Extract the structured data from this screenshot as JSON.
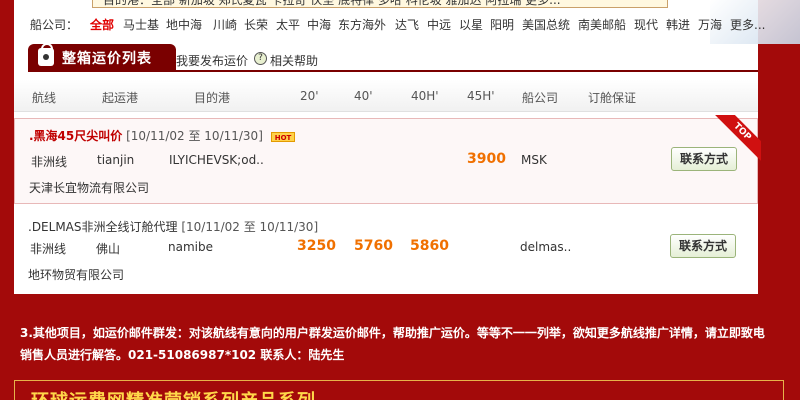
{
  "top_strip": {
    "text": "目的港：全部  新加坡  郑氏夏瓦  卡拉奇  伙坚  底特律  多哈  科伦坡  雅加达  阿拉瑞  更多..."
  },
  "carrier_filter": {
    "label": "船公司：",
    "items": [
      {
        "label": "全部",
        "active": true
      },
      {
        "label": "马士基"
      },
      {
        "label": "地中海"
      },
      {
        "label": "川崎"
      },
      {
        "label": "长荣"
      },
      {
        "label": "太平"
      },
      {
        "label": "中海"
      },
      {
        "label": "东方海外"
      },
      {
        "label": "达飞"
      },
      {
        "label": "中远"
      },
      {
        "label": "以星"
      },
      {
        "label": "阳明"
      },
      {
        "label": "美国总统"
      },
      {
        "label": "南美邮船"
      },
      {
        "label": "现代"
      },
      {
        "label": "韩进"
      },
      {
        "label": "万海"
      },
      {
        "label": "更多..."
      }
    ]
  },
  "tab": {
    "label": "整箱运价列表",
    "icon": "lock-icon",
    "publish_link": "我要发布运价",
    "help_icon": "?",
    "help_link": "相关帮助"
  },
  "table": {
    "headers": [
      "航线",
      "起运港",
      "目的港",
      "20'",
      "40'",
      "40H'",
      "45H'",
      "船公司",
      "订舱保证"
    ],
    "rows": [
      {
        "title": ".黑海45尺尖叫价",
        "date_range": "[10/11/02 至 10/11/30]",
        "hot_badge": "HOT",
        "ribbon": "TOP",
        "route": "非洲线",
        "origin": "tianjin",
        "destination": "ILYICHEVSK;od..",
        "price_20": "",
        "price_40": "",
        "price_40h": "",
        "price_45h": "3900",
        "carrier": "MSK",
        "company": "天津长宜物流有限公司",
        "contact": "联系方式"
      },
      {
        "title": ".DELMAS非洲全线订舱代理",
        "date_range": "[10/11/02 至 10/11/30]",
        "route": "非洲线",
        "origin": "佛山",
        "destination": "namibe",
        "price_20": "3250",
        "price_40": "5760",
        "price_40h": "5860",
        "price_45h": "",
        "carrier": "delmas..",
        "company": "地环物贸有限公司",
        "contact": "联系方式"
      }
    ]
  },
  "note": {
    "line1": "3.其他项目，如运价邮件群发：对该航线有意向的用户群发运价邮件，帮助推广运价。等等不一一列举，欲知更多航线推广详情，请立即致电",
    "line2": "销售人员进行解答。021-51086987*102 联系人：陆先生"
  },
  "footer": {
    "title": "环球运费网精准营销系列产品系列"
  },
  "colors": {
    "background": "#a30a0a",
    "active_filter": "#e00000",
    "price": "#f07000",
    "tab": "#7a0000",
    "footer_title": "#ffd84a"
  }
}
